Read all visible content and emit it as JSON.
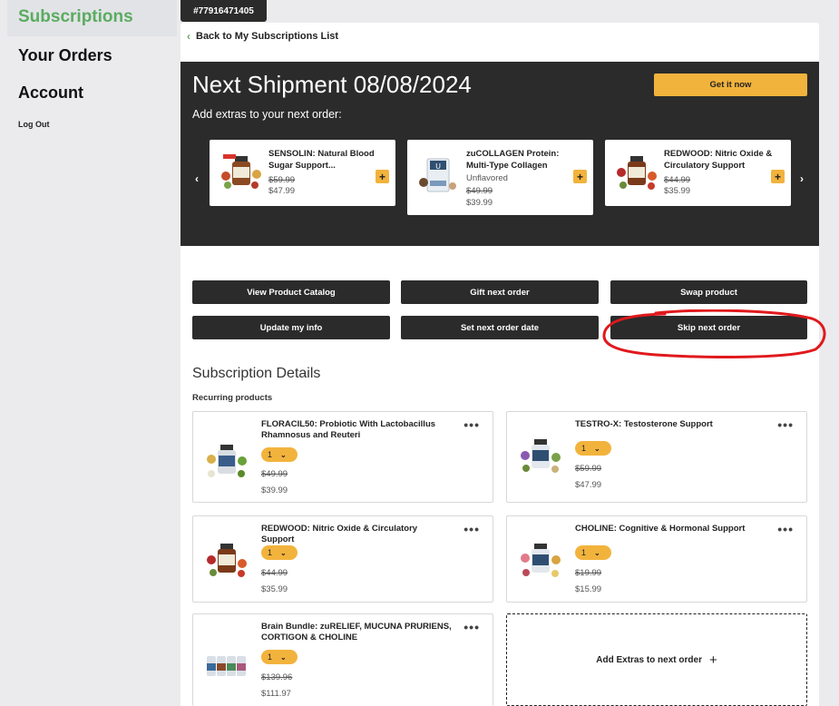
{
  "sidebar": {
    "items": [
      {
        "label": "Subscriptions",
        "active": true
      },
      {
        "label": "Your Orders",
        "active": false
      },
      {
        "label": "Account",
        "active": false
      }
    ],
    "logout_label": "Log Out"
  },
  "order": {
    "id": "#77916471405"
  },
  "back_link": "Back to My Subscriptions List",
  "banner": {
    "title": "Next Shipment 08/08/2024",
    "subtitle": "Add extras to your next order:",
    "get_it_now": "Get it now",
    "prev_arrow": "‹",
    "next_arrow": "›",
    "products": [
      {
        "name": "SENSOLIN: Natural Blood Sugar Support...",
        "variant": "",
        "old_price": "$59.99",
        "new_price": "$47.99",
        "add": "+"
      },
      {
        "name": "zuCOLLAGEN Protein: Multi-Type Collagen",
        "variant": "Unflavored",
        "old_price": "$49.99",
        "new_price": "$39.99",
        "add": "+"
      },
      {
        "name": "REDWOOD: Nitric Oxide & Circulatory Support",
        "variant": "",
        "old_price": "$44.99",
        "new_price": "$35.99",
        "add": "+"
      }
    ]
  },
  "actions": [
    "View Product Catalog",
    "Gift next order",
    "Swap product",
    "Update my info",
    "Set next order date",
    "Skip next order"
  ],
  "details": {
    "title": "Subscription Details",
    "recurring_label": "Recurring products",
    "items": [
      {
        "name": "FLORACIL50: Probiotic With Lactobacillus Rhamnosus and Reuteri",
        "qty": "1",
        "old_price": "$49.99",
        "new_price": "$39.99",
        "menu": "•••"
      },
      {
        "name": "TESTRO-X: Testosterone Support",
        "qty": "1",
        "old_price": "$59.99",
        "new_price": "$47.99",
        "menu": "•••"
      },
      {
        "name": "REDWOOD: Nitric Oxide & Circulatory Support",
        "qty": "1",
        "old_price": "$44.99",
        "new_price": "$35.99",
        "menu": "•••"
      },
      {
        "name": "CHOLINE: Cognitive & Hormonal Support",
        "qty": "1",
        "old_price": "$19.99",
        "new_price": "$15.99",
        "menu": "•••"
      },
      {
        "name": "Brain Bundle: zuRELIEF, MUCUNA PRURIENS, CORTIGON & CHOLINE",
        "qty": "1",
        "old_price": "$139.96",
        "new_price": "$111.97",
        "menu": "•••"
      }
    ],
    "add_extras_label": "Add Extras to next order",
    "add_extras_icon": "+"
  },
  "colors": {
    "accent_green": "#5aac5f",
    "accent_yellow": "#f2b33d",
    "dark": "#2b2b2b",
    "annotation_red": "#e0191c"
  }
}
